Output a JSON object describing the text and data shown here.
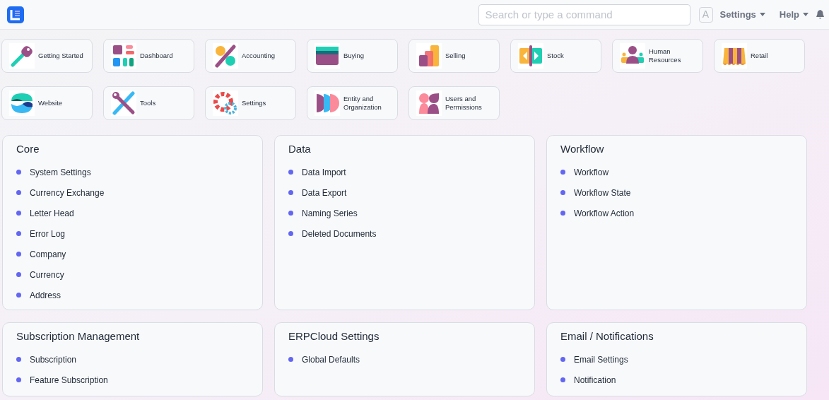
{
  "navbar": {
    "search": {
      "placeholder": "Search or type a command"
    },
    "avatar": "A",
    "menus": [
      "Settings",
      "Help"
    ]
  },
  "modules": [
    {
      "label": "Getting Started"
    },
    {
      "label": "Dashboard"
    },
    {
      "label": "Accounting"
    },
    {
      "label": "Buying"
    },
    {
      "label": "Selling"
    },
    {
      "label": "Stock"
    },
    {
      "label": "Human Resources"
    },
    {
      "label": "Retail"
    },
    {
      "label": "Website"
    },
    {
      "label": "Tools"
    },
    {
      "label": "Settings"
    },
    {
      "label": "Entity and Organization"
    },
    {
      "label": "Users and Permissions"
    }
  ],
  "sections": [
    {
      "title": "Core",
      "links": [
        "System Settings",
        "Currency Exchange",
        "Letter Head",
        "Error Log",
        "Company",
        "Currency",
        "Address"
      ]
    },
    {
      "title": "Data",
      "links": [
        "Data Import",
        "Data Export",
        "Naming Series",
        "Deleted Documents"
      ]
    },
    {
      "title": "Workflow",
      "links": [
        "Workflow",
        "Workflow State",
        "Workflow Action"
      ]
    },
    {
      "title": "Subscription Management",
      "links": [
        "Subscription",
        "Feature Subscription"
      ]
    },
    {
      "title": "ERPCloud Settings",
      "links": [
        "Global Defaults"
      ]
    },
    {
      "title": "Email / Notifications",
      "links": [
        "Email Settings",
        "Notification"
      ]
    }
  ]
}
